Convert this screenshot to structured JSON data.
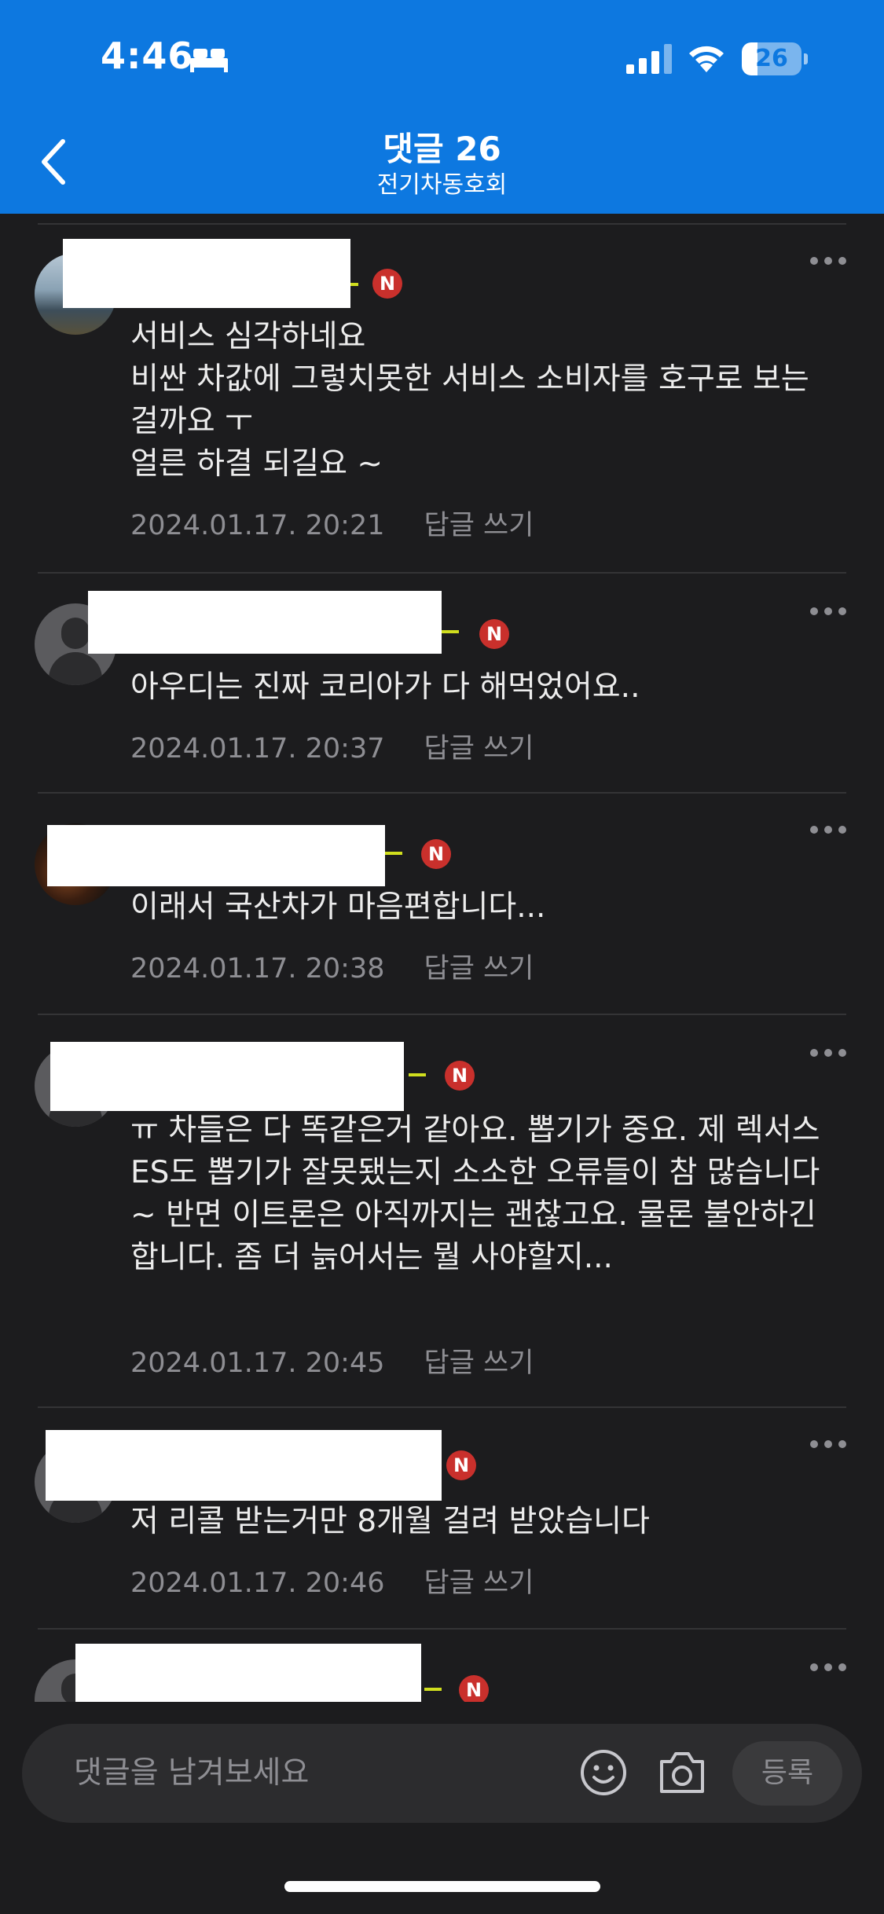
{
  "status_bar": {
    "time": "4:46",
    "battery": "26",
    "battery_level": 0.26
  },
  "header": {
    "title": "댓글 26",
    "subtitle": "전기차동호회",
    "accent": "#0d78e0"
  },
  "comments": [
    {
      "text": "서비스 심각하네요\n비싼 차값에 그렇치못한 서비스 소비자를 호구로 보는걸까요 ㅜ\n얼른 하결 되길요 ~",
      "date": "2024.01.17. 20:21",
      "reply_label": "답글 쓰기",
      "badge": "N"
    },
    {
      "text": "아우디는 진짜 코리아가 다 해먹었어요..",
      "date": "2024.01.17. 20:37",
      "reply_label": "답글 쓰기",
      "badge": "N"
    },
    {
      "text": "이래서 국산차가 마음편합니다...",
      "date": "2024.01.17. 20:38",
      "reply_label": "답글 쓰기",
      "badge": "N"
    },
    {
      "text": "ㅠ 차들은 다 똑같은거 같아요. 뽑기가 중요. 제 렉서스 ES도 뽑기가 잘못됐는지 소소한 오류들이 참 많습니다~ 반면 이트론은 아직까지는 괜찮고요. 물론 불안하긴 합니다. 좀 더 늙어서는 뭘 사야할지...",
      "date": "2024.01.17. 20:45",
      "reply_label": "답글 쓰기",
      "badge": "N"
    },
    {
      "text": "저 리콜 받는거만 8개월 걸려 받았습니다",
      "date": "2024.01.17. 20:46",
      "reply_label": "답글 쓰기",
      "badge": "N"
    },
    {
      "badge": "N"
    }
  ],
  "input": {
    "placeholder": "댓글을 남겨보세요",
    "submit_label": "등록"
  },
  "icons": [
    "sleep-icon",
    "signal-icon",
    "wifi-icon",
    "back-icon",
    "more-icon",
    "emoji-icon",
    "camera-icon"
  ]
}
